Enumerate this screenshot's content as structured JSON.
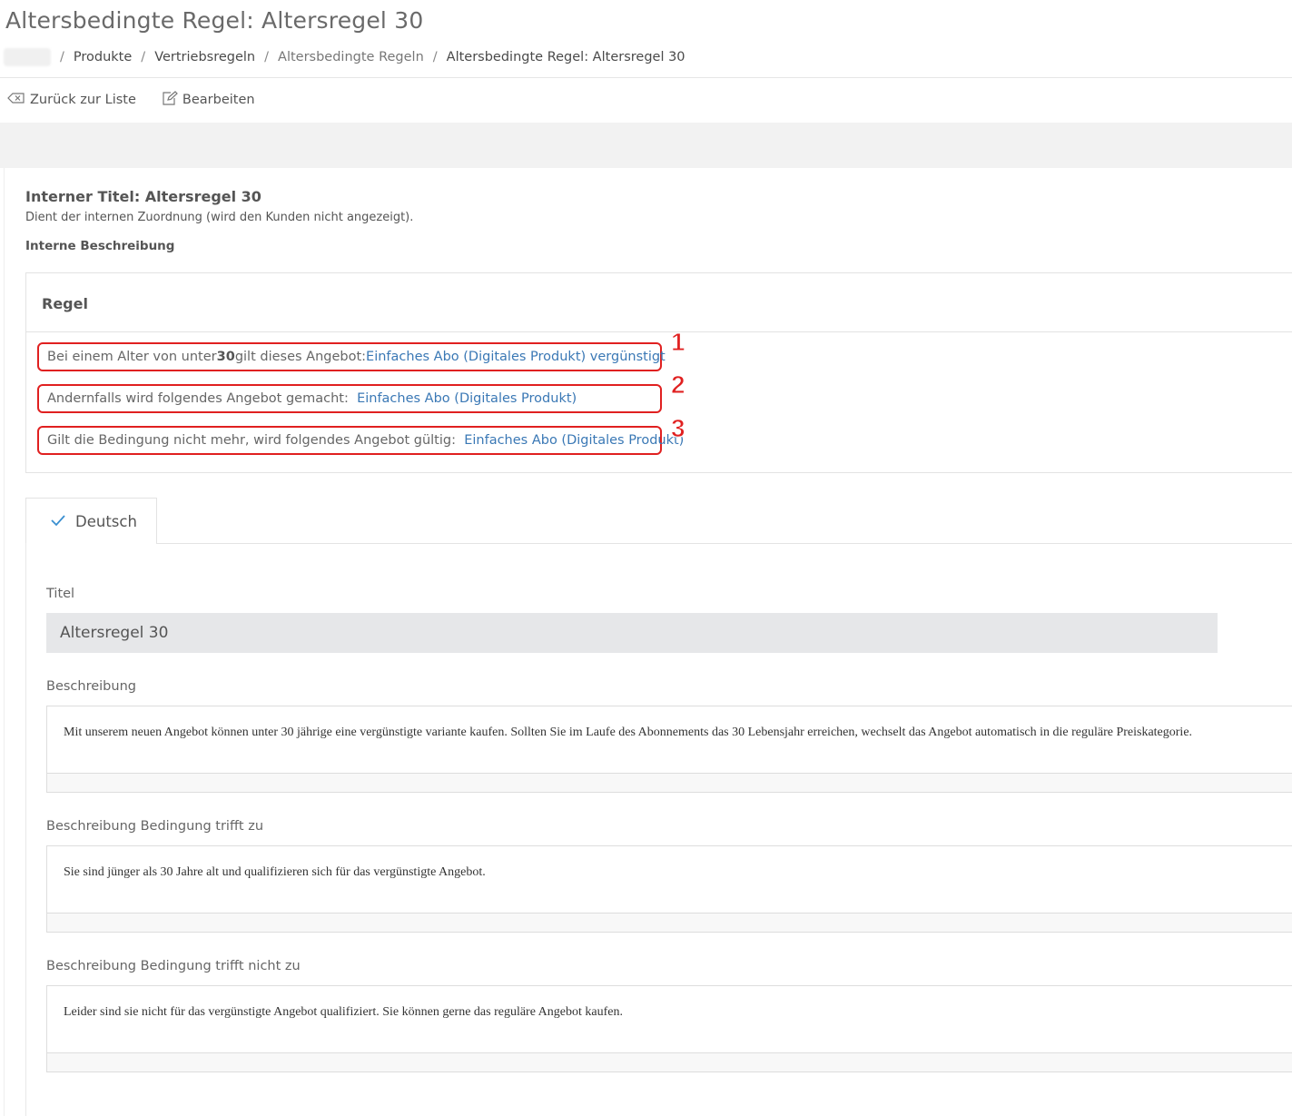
{
  "page": {
    "title": "Altersbedingte Regel: Altersregel 30"
  },
  "breadcrumb": {
    "items": [
      "Produkte",
      "Vertriebsregeln",
      "Altersbedingte Regeln",
      "Altersbedingte Regel: Altersregel 30"
    ],
    "separator": "/"
  },
  "toolbar": {
    "back_label": "Zurück zur Liste",
    "edit_label": "Bearbeiten"
  },
  "internal": {
    "title": "Interner Titel: Altersregel 30",
    "hint": "Dient der internen Zuordnung (wird den Kunden nicht angezeigt).",
    "description_label": "Interne Beschreibung"
  },
  "rule": {
    "heading": "Regel",
    "line1_prefix": "Bei einem Alter von unter ",
    "line1_age": "30",
    "line1_suffix": " gilt dieses Angebot: ",
    "line1_link": "Einfaches Abo (Digitales Produkt) vergünstigt",
    "line2_prefix": "Andernfalls wird folgendes Angebot gemacht:  ",
    "line2_link": "Einfaches Abo (Digitales Produkt)",
    "line3_prefix": "Gilt die Bedingung nicht mehr, wird folgendes Angebot gültig:  ",
    "line3_link": "Einfaches Abo (Digitales Produkt)",
    "markers": [
      "1",
      "2",
      "3"
    ]
  },
  "tabs": {
    "german_label": "Deutsch"
  },
  "form": {
    "title_label": "Titel",
    "title_value": "Altersregel 30",
    "description_label": "Beschreibung",
    "description_value": "Mit unserem neuen Angebot können unter 30 jährige eine vergünstigte variante kaufen. Sollten Sie im Laufe des Abonnements das 30 Lebensjahr erreichen, wechselt das Angebot automatisch in die reguläre Preiskategorie.",
    "cond_true_label": "Beschreibung Bedingung trifft zu",
    "cond_true_value": "Sie sind jünger als 30 Jahre alt und qualifizieren sich für das vergünstigte Angebot.",
    "cond_false_label": "Beschreibung Bedingung trifft nicht zu",
    "cond_false_value": "Leider sind sie nicht für das vergünstigte Angebot qualifiziert. Sie können gerne das reguläre Angebot kaufen."
  },
  "colors": {
    "link": "#3a78b5",
    "highlight": "#e02020",
    "input_bg": "#e6e7e9",
    "band_bg": "#f2f2f2"
  }
}
